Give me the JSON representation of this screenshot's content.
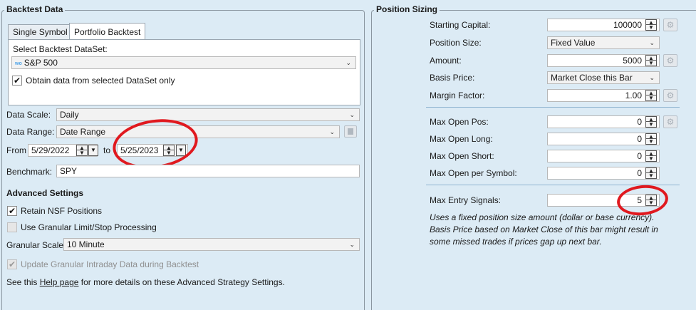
{
  "left": {
    "title": "Backtest Data",
    "tabs": [
      "Single Symbol",
      "Portfolio Backtest"
    ],
    "dataset_label": "Select Backtest DataSet:",
    "dataset_icon_text": "wo",
    "dataset_value": "S&P 500",
    "dataset_only_label": "Obtain data from selected DataSet only",
    "data_scale_label": "Data Scale:",
    "data_scale_value": "Daily",
    "data_range_label": "Data Range:",
    "data_range_value": "Date Range",
    "from_label": "From",
    "from_value": "5/29/2022",
    "to_label": "to",
    "to_value": "5/25/2023",
    "benchmark_label": "Benchmark:",
    "benchmark_value": "SPY",
    "advanced_title": "Advanced Settings",
    "retain_nsf_label": "Retain NSF Positions",
    "granular_limit_label": "Use Granular Limit/Stop Processing",
    "granular_scale_label": "Granular Scale",
    "granular_scale_value": "10 Minute",
    "update_granular_label": "Update Granular Intraday Data during Backtest",
    "help_prefix": "See this",
    "help_link": "Help page",
    "help_suffix": "for more details on these Advanced Strategy Settings."
  },
  "right": {
    "title": "Position Sizing",
    "starting_capital_label": "Starting Capital:",
    "starting_capital_value": "100000",
    "position_size_label": "Position Size:",
    "position_size_value": "Fixed Value",
    "amount_label": "Amount:",
    "amount_value": "5000",
    "basis_price_label": "Basis Price:",
    "basis_price_value": "Market Close this Bar",
    "margin_factor_label": "Margin Factor:",
    "margin_factor_value": "1.00",
    "max_open_pos_label": "Max Open Pos:",
    "max_open_pos_value": "0",
    "max_open_long_label": "Max Open Long:",
    "max_open_long_value": "0",
    "max_open_short_label": "Max Open Short:",
    "max_open_short_value": "0",
    "max_open_symbol_label": "Max Open per Symbol:",
    "max_open_symbol_value": "0",
    "max_entry_label": "Max Entry Signals:",
    "max_entry_value": "5",
    "note_line1": "Uses a fixed position size amount (dollar or base currency).",
    "note_line2": "Basis Price based on Market Close of this bar might result in",
    "note_line3": "some missed trades if prices gap up next bar."
  },
  "icons": {
    "spin_up": "▲",
    "spin_down": "▼",
    "dropdown": "⌄",
    "check": "✔",
    "gear": "⚙"
  }
}
